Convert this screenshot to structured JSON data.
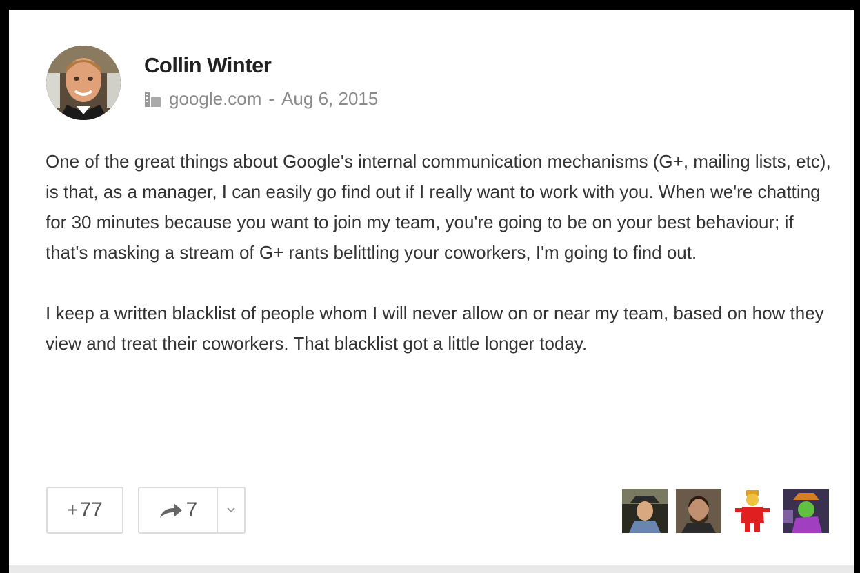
{
  "post": {
    "author": "Collin Winter",
    "domain": "google.com",
    "separator": "-",
    "date": "Aug 6, 2015",
    "paragraphs": [
      "One of the great things about Google's internal communication mechanisms (G+, mailing lists, etc), is that, as a manager, I can easily go find out if I really want to work with you. When we're chatting for 30 minutes because you want to join my team, you're going to be on your best behaviour; if that's masking a stream of G+ rants belittling your coworkers, I'm going to find out.",
      "I keep a written blacklist of people whom I will never allow on or near my team, based on how they view and treat their coworkers. That blacklist got a little longer today."
    ]
  },
  "actions": {
    "plus_sign": "+",
    "plus_count": "77",
    "share_count": "7"
  },
  "icons": {
    "avatar": "author-avatar",
    "domain": "building-icon",
    "share": "share-arrow-icon",
    "more": "chevron-down-icon"
  },
  "colors": {
    "text": "#333333",
    "meta": "#8a8a8a",
    "border": "#dcdcdc"
  }
}
